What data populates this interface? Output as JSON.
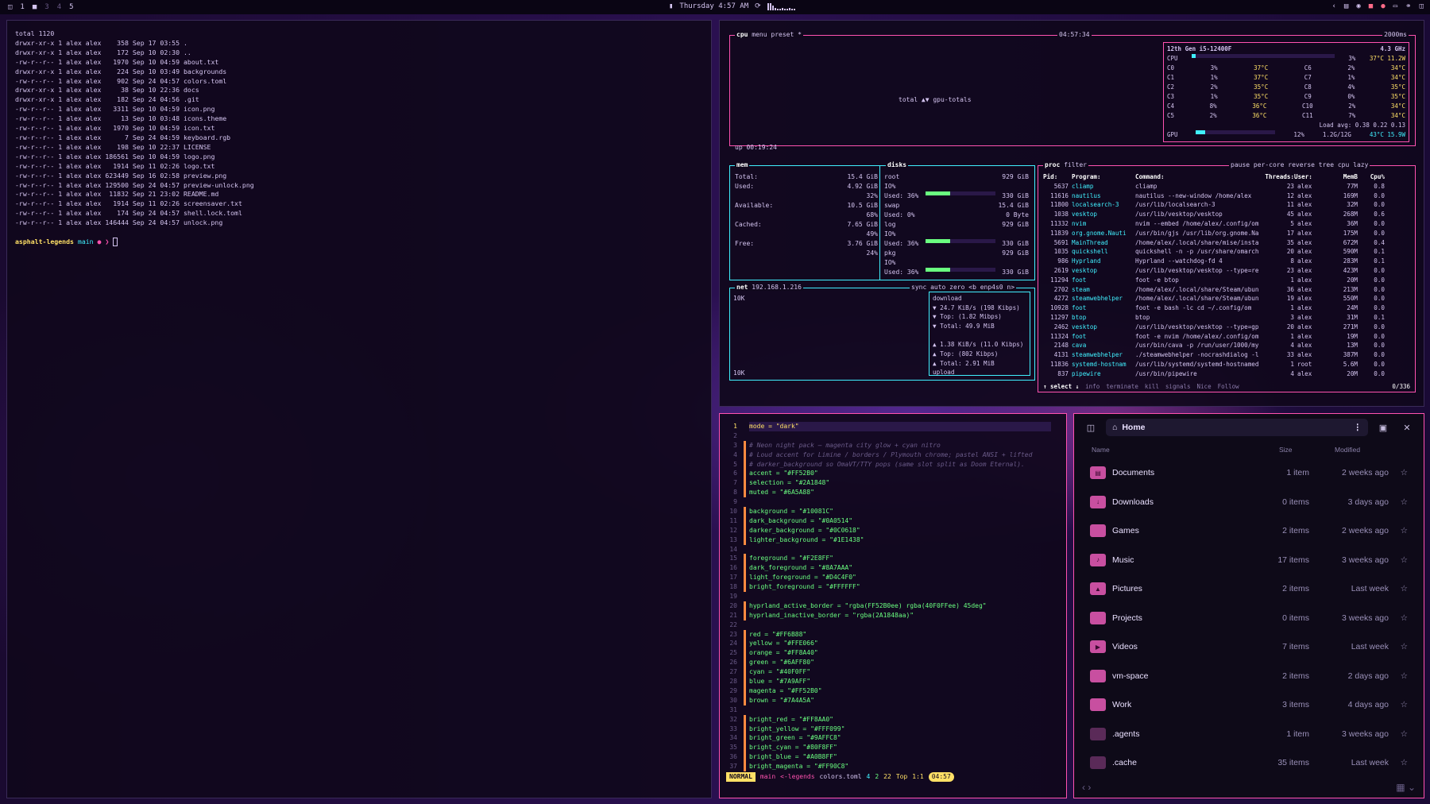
{
  "topbar": {
    "workspaces": [
      "1",
      "2",
      "3",
      "4",
      "5"
    ],
    "clock": "Thursday 4:57 AM",
    "colors": {
      "accent": "#FF52B0",
      "cyan": "#40F0FF"
    }
  },
  "terminal": {
    "lines": [
      "total 1120",
      "drwxr-xr-x 1 alex alex    358 Sep 17 03:55 .",
      "drwxr-xr-x 1 alex alex    172 Sep 10 02:30 ..",
      "-rw-r--r-- 1 alex alex   1970 Sep 10 04:59 about.txt",
      "drwxr-xr-x 1 alex alex    224 Sep 10 03:49 backgrounds",
      "-rw-r--r-- 1 alex alex    902 Sep 24 04:57 colors.toml",
      "drwxr-xr-x 1 alex alex     38 Sep 10 22:36 docs",
      "drwxr-xr-x 1 alex alex    182 Sep 24 04:56 .git",
      "-rw-r--r-- 1 alex alex   3311 Sep 10 04:59 icon.png",
      "-rw-r--r-- 1 alex alex     13 Sep 10 03:48 icons.theme",
      "-rw-r--r-- 1 alex alex   1970 Sep 10 04:59 icon.txt",
      "-rw-r--r-- 1 alex alex      7 Sep 24 04:59 keyboard.rgb",
      "-rw-r--r-- 1 alex alex    198 Sep 10 22:37 LICENSE",
      "-rw-r--r-- 1 alex alex 186561 Sep 10 04:59 logo.png",
      "-rw-r--r-- 1 alex alex   1914 Sep 11 02:26 logo.txt",
      "-rw-r--r-- 1 alex alex 623449 Sep 16 02:58 preview.png",
      "-rw-r--r-- 1 alex alex 129500 Sep 24 04:57 preview-unlock.png",
      "-rw-r--r-- 1 alex alex  11832 Sep 21 23:02 README.md",
      "-rw-r--r-- 1 alex alex   1914 Sep 11 02:26 screensaver.txt",
      "-rw-r--r-- 1 alex alex    174 Sep 24 04:57 shell.lock.toml",
      "-rw-r--r-- 1 alex alex 146444 Sep 24 04:57 unlock.png"
    ],
    "prompt_dir": "asphalt-legends",
    "prompt_branch": "main",
    "prompt_mark": "●",
    "prompt_arrow": "❯"
  },
  "btop": {
    "cpu_title": "cpu",
    "menu": "menu",
    "preset": "preset *",
    "time": "04:57:34",
    "interval": "2000ms",
    "graph_label": "total ▲▼ gpu-totals",
    "uptime": "up 00:19:24",
    "cpu_model": "12th Gen i5-12400F",
    "cpu_freq": "4.3 GHz",
    "cpu_total": "CPU",
    "cpu_total_pct": "3%",
    "cpu_total_temp": "37°C 11.2W",
    "cores": [
      [
        "C0",
        "3%",
        "37°C",
        "C6",
        "2%",
        "34°C"
      ],
      [
        "C1",
        "1%",
        "37°C",
        "C7",
        "1%",
        "34°C"
      ],
      [
        "C2",
        "2%",
        "35°C",
        "C8",
        "4%",
        "35°C"
      ],
      [
        "C3",
        "1%",
        "35°C",
        "C9",
        "0%",
        "35°C"
      ],
      [
        "C4",
        "8%",
        "36°C",
        "C10",
        "2%",
        "34°C"
      ],
      [
        "C5",
        "2%",
        "36°C",
        "C11",
        "7%",
        "34°C"
      ]
    ],
    "load_avg": "Load avg: 0.38 0.22 0.13",
    "gpu_label": "GPU",
    "gpu_pct": "12%",
    "gpu_mem": "1.2G/12G",
    "gpu_temp": "43°C 15.9W",
    "mem_title": "mem",
    "disks_title": "disks",
    "mem": [
      [
        "Total:",
        "15.4 GiB"
      ],
      [
        "Used:",
        "4.92 GiB"
      ],
      [
        "",
        "32%"
      ],
      [
        "Available:",
        "10.5 GiB"
      ],
      [
        "",
        "68%"
      ],
      [
        "Cached:",
        "7.65 GiB"
      ],
      [
        "",
        "49%"
      ],
      [
        "Free:",
        "3.76 GiB"
      ],
      [
        "",
        "24%"
      ]
    ],
    "disks": [
      [
        "root",
        "929 GiB"
      ],
      [
        "IO%",
        ""
      ],
      [
        "Used: 36%",
        "330 GiB"
      ],
      [
        "swap",
        "15.4 GiB"
      ],
      [
        "Used:  0%",
        "0 Byte"
      ],
      [
        "log",
        "929 GiB"
      ],
      [
        "IO%",
        ""
      ],
      [
        "Used: 36%",
        "330 GiB"
      ],
      [
        "pkg",
        "929 GiB"
      ],
      [
        "IO%",
        ""
      ],
      [
        "Used: 36%",
        "330 GiB"
      ]
    ],
    "net_title": "net",
    "net_ip": "192.168.1.216",
    "net_opts": "sync auto zero <b enp4s0 n>",
    "net_scale_top": "10K",
    "net_scale_bottom": "10K",
    "download": [
      "download",
      "▼ 24.7 KiB/s  (198 Kibps)",
      "▼ Top:      (1.82 Mibps)",
      "▼ Total:      49.9 MiB"
    ],
    "upload": [
      "▲ 1.38 KiB/s  (11.0 Kibps)",
      "▲ Top:       (802 Kibps)",
      "▲ Total:      2.91 MiB",
      "upload"
    ],
    "proc_title": "proc",
    "proc_filter": "filter",
    "proc_opts": "pause per-core reverse tree cpu lazy",
    "proc_header": [
      "Pid:",
      "Program:",
      "Command:",
      "Threads:",
      "User:",
      "MemB",
      "Cpu%"
    ],
    "procs": [
      [
        "5637",
        "cliamp",
        "cliamp",
        "23",
        "alex",
        "77M",
        "0.8"
      ],
      [
        "11616",
        "nautilus",
        "nautilus --new-window /home/alex",
        "12",
        "alex",
        "169M",
        "0.0"
      ],
      [
        "11800",
        "localsearch-3",
        "/usr/lib/localsearch-3",
        "11",
        "alex",
        "32M",
        "0.0"
      ],
      [
        "1038",
        "vesktop",
        "/usr/lib/vesktop/vesktop",
        "45",
        "alex",
        "268M",
        "0.6"
      ],
      [
        "11332",
        "nvim",
        "nvim --embed /home/alex/.config/om",
        "5",
        "alex",
        "36M",
        "0.0"
      ],
      [
        "11839",
        "org.gnome.Nauti",
        "/usr/bin/gjs /usr/lib/org.gnome.Na",
        "17",
        "alex",
        "175M",
        "0.0"
      ],
      [
        "5691",
        "MainThread",
        "/home/alex/.local/share/mise/insta",
        "35",
        "alex",
        "672M",
        "0.4"
      ],
      [
        "1035",
        "quickshell",
        "quickshell -n -p /usr/share/omarch",
        "20",
        "alex",
        "590M",
        "0.1"
      ],
      [
        "986",
        "Hyprland",
        "Hyprland --watchdog-fd 4",
        "8",
        "alex",
        "283M",
        "0.1"
      ],
      [
        "2619",
        "vesktop",
        "/usr/lib/vesktop/vesktop --type=re",
        "23",
        "alex",
        "423M",
        "0.0"
      ],
      [
        "11294",
        "foot",
        "foot -e btop",
        "1",
        "alex",
        "20M",
        "0.0"
      ],
      [
        "2702",
        "steam",
        "/home/alex/.local/share/Steam/ubun",
        "36",
        "alex",
        "213M",
        "0.0"
      ],
      [
        "4272",
        "steamwebhelper",
        "/home/alex/.local/share/Steam/ubun",
        "19",
        "alex",
        "550M",
        "0.0"
      ],
      [
        "10928",
        "foot",
        "foot -e bash -lc cd ~/.config/om",
        "1",
        "alex",
        "24M",
        "0.0"
      ],
      [
        "11297",
        "btop",
        "btop",
        "3",
        "alex",
        "31M",
        "0.1"
      ],
      [
        "2462",
        "vesktop",
        "/usr/lib/vesktop/vesktop --type=gp",
        "20",
        "alex",
        "271M",
        "0.0"
      ],
      [
        "11324",
        "foot",
        "foot -e nvim /home/alex/.config/om",
        "1",
        "alex",
        "19M",
        "0.0"
      ],
      [
        "2148",
        "cava",
        "/usr/bin/cava -p /run/user/1000/my",
        "4",
        "alex",
        "13M",
        "0.0"
      ],
      [
        "4131",
        "steamwebhelper",
        "./steamwebhelper -nocrashdialog -l",
        "33",
        "alex",
        "387M",
        "0.0"
      ],
      [
        "11836",
        "systemd-hostnam",
        "/usr/lib/systemd/systemd-hostnamed",
        "1",
        "root",
        "5.6M",
        "0.0"
      ],
      [
        "837",
        "pipewire",
        "/usr/bin/pipewire",
        "4",
        "alex",
        "20M",
        "0.0"
      ]
    ],
    "proc_footer": [
      "↑ select ↓",
      "info",
      "terminate",
      "kill",
      "signals",
      "Nice",
      "Follow"
    ],
    "proc_count": "0/336"
  },
  "editor": {
    "lines": [
      [
        "1",
        "mode = \"dark\"",
        ""
      ],
      [
        "2",
        "",
        ""
      ],
      [
        "3",
        "# Neon night pack — magenta city glow + cyan nitro",
        "cm"
      ],
      [
        "4",
        "# Loud accent for Limine / borders / Plymouth chrome; pastel ANSI + lifted",
        "cm"
      ],
      [
        "5",
        "# darker_background so OmaVT/TTY pops (same slot split as Doom Eternal).",
        "cm"
      ],
      [
        "6",
        "accent = \"#FF52B0\"",
        ""
      ],
      [
        "7",
        "selection = \"#2A1848\"",
        ""
      ],
      [
        "8",
        "muted = \"#6A5A88\"",
        ""
      ],
      [
        "9",
        "",
        ""
      ],
      [
        "10",
        "background = \"#10081C\"",
        ""
      ],
      [
        "11",
        "dark_background = \"#0A0514\"",
        ""
      ],
      [
        "12",
        "darker_background = \"#0C0618\"",
        ""
      ],
      [
        "13",
        "lighter_background = \"#1E1438\"",
        ""
      ],
      [
        "14",
        "",
        ""
      ],
      [
        "15",
        "foreground = \"#F2E8FF\"",
        ""
      ],
      [
        "16",
        "dark_foreground = \"#8A7AAA\"",
        ""
      ],
      [
        "17",
        "light_foreground = \"#D4C4F0\"",
        ""
      ],
      [
        "18",
        "bright_foreground = \"#FFFFFF\"",
        ""
      ],
      [
        "19",
        "",
        ""
      ],
      [
        "20",
        "hyprland_active_border = \"rgba(FF52B0ee) rgba(40F0FFee) 45deg\"",
        ""
      ],
      [
        "21",
        "hyprland_inactive_border = \"rgba(2A1848aa)\"",
        ""
      ],
      [
        "22",
        "",
        ""
      ],
      [
        "23",
        "red = \"#FF6B88\"",
        ""
      ],
      [
        "24",
        "yellow = \"#FFE066\"",
        ""
      ],
      [
        "25",
        "orange = \"#FF8A40\"",
        ""
      ],
      [
        "26",
        "green = \"#6AFF80\"",
        ""
      ],
      [
        "27",
        "cyan = \"#40F0FF\"",
        ""
      ],
      [
        "28",
        "blue = \"#7A9AFF\"",
        ""
      ],
      [
        "29",
        "magenta = \"#FF52B0\"",
        ""
      ],
      [
        "30",
        "brown = \"#7A4A5A\"",
        ""
      ],
      [
        "31",
        "",
        ""
      ],
      [
        "32",
        "bright_red = \"#FF8AA0\"",
        ""
      ],
      [
        "33",
        "bright_yellow = \"#FFF099\"",
        ""
      ],
      [
        "34",
        "bright_green = \"#9AFFC8\"",
        ""
      ],
      [
        "35",
        "bright_cyan = \"#80F8FF\"",
        ""
      ],
      [
        "36",
        "bright_blue = \"#A0B8FF\"",
        ""
      ],
      [
        "37",
        "bright_magenta = \"#FF90C8\"",
        ""
      ]
    ],
    "status": {
      "mode": "NORMAL",
      "branch": "main",
      "legends": "<-legends",
      "file": "colors.toml",
      "diag1": "4",
      "diag2": "2",
      "diag3": "22",
      "pos": "Top",
      "cursor": "1:1",
      "time": "04:57"
    }
  },
  "filemanager": {
    "title": "Home",
    "col_name": "Name",
    "col_size": "Size",
    "col_modified": "Modified",
    "items": [
      {
        "name": "Documents",
        "size": "1 item",
        "modified": "2 weeks ago",
        "icon": "folder-documents-icon"
      },
      {
        "name": "Downloads",
        "size": "0 items",
        "modified": "3 days ago",
        "icon": "folder-downloads-icon"
      },
      {
        "name": "Games",
        "size": "2 items",
        "modified": "2 weeks ago",
        "icon": "folder-icon"
      },
      {
        "name": "Music",
        "size": "17 items",
        "modified": "3 weeks ago",
        "icon": "folder-music-icon"
      },
      {
        "name": "Pictures",
        "size": "2 items",
        "modified": "Last week",
        "icon": "folder-pictures-icon"
      },
      {
        "name": "Projects",
        "size": "0 items",
        "modified": "3 weeks ago",
        "icon": "folder-icon"
      },
      {
        "name": "Videos",
        "size": "7 items",
        "modified": "Last week",
        "icon": "folder-videos-icon"
      },
      {
        "name": "vm-space",
        "size": "2 items",
        "modified": "2 days ago",
        "icon": "folder-icon"
      },
      {
        "name": "Work",
        "size": "3 items",
        "modified": "4 days ago",
        "icon": "folder-icon"
      },
      {
        "name": ".agents",
        "size": "1 item",
        "modified": "3 weeks ago",
        "icon": "folder-hidden-icon"
      },
      {
        "name": ".cache",
        "size": "35 items",
        "modified": "Last week",
        "icon": "folder-hidden-icon"
      }
    ]
  }
}
